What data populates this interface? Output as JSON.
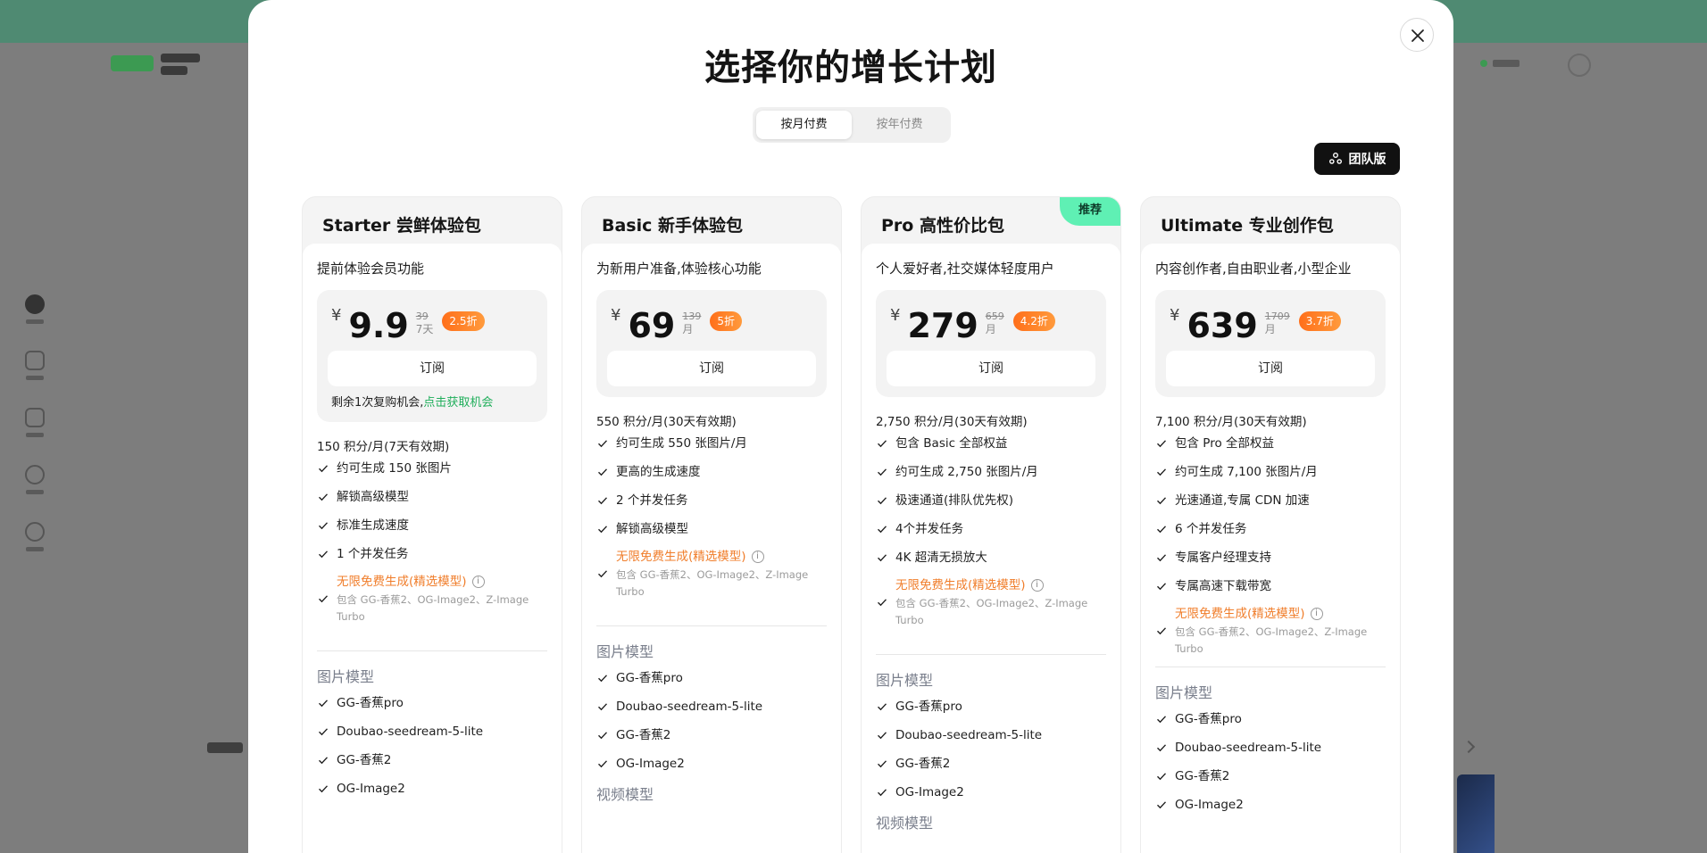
{
  "modal": {
    "title": "选择你的增长计划",
    "billing": {
      "monthly": "按月付费",
      "yearly": "按年付费",
      "active": "monthly"
    },
    "team_button": "团队版",
    "close_label": "关闭"
  },
  "plans": [
    {
      "name": "Starter 尝鲜体验包",
      "tagline": "提前体验会员功能",
      "currency": "¥",
      "price": "9.9",
      "original_price": "39",
      "period": "7天",
      "discount": "2.5折",
      "subscribe": "订阅",
      "note": "剩余1次复购机会,",
      "note_link": "点击获取机会",
      "credits": "150 积分/月(7天有效期)",
      "features": [
        "约可生成 150 张图片",
        "解锁高级模型",
        "标准生成速度",
        "1 个并发任务"
      ],
      "free_title": "无限免费生成(精选模型)",
      "free_sub": "包含 GG-香蕉2、OG-Image2、Z-Image Turbo",
      "image_models_title": "图片模型",
      "image_models": [
        "GG-香蕉pro",
        "Doubao-seedream-5-lite",
        "GG-香蕉2",
        "OG-Image2"
      ]
    },
    {
      "name": "Basic 新手体验包",
      "tagline": "为新用户准备,体验核心功能",
      "currency": "¥",
      "price": "69",
      "original_price": "139",
      "period": "月",
      "discount": "5折",
      "subscribe": "订阅",
      "credits": "550 积分/月(30天有效期)",
      "features": [
        "约可生成 550 张图片/月",
        "更高的生成速度",
        "2 个并发任务",
        "解锁高级模型"
      ],
      "free_title": "无限免费生成(精选模型)",
      "free_sub": "包含 GG-香蕉2、OG-Image2、Z-Image Turbo",
      "image_models_title": "图片模型",
      "image_models": [
        "GG-香蕉pro",
        "Doubao-seedream-5-lite",
        "GG-香蕉2",
        "OG-Image2"
      ],
      "video_models_title": "视频模型"
    },
    {
      "name": "Pro 高性价比包",
      "badge": "推荐",
      "tagline": "个人爱好者,社交媒体轻度用户",
      "currency": "¥",
      "price": "279",
      "original_price": "659",
      "period": "月",
      "discount": "4.2折",
      "subscribe": "订阅",
      "credits": "2,750 积分/月(30天有效期)",
      "features": [
        "包含 Basic 全部权益",
        "约可生成 2,750 张图片/月",
        "极速通道(排队优先权)",
        "4个并发任务",
        "4K 超清无损放大"
      ],
      "free_title": "无限免费生成(精选模型)",
      "free_sub": "包含 GG-香蕉2、OG-Image2、Z-Image Turbo",
      "image_models_title": "图片模型",
      "image_models": [
        "GG-香蕉pro",
        "Doubao-seedream-5-lite",
        "GG-香蕉2",
        "OG-Image2"
      ],
      "video_models_title": "视频模型"
    },
    {
      "name": "Ultimate 专业创作包",
      "tagline": "内容创作者,自由职业者,小型企业",
      "currency": "¥",
      "price": "639",
      "original_price": "1709",
      "period": "月",
      "discount": "3.7折",
      "subscribe": "订阅",
      "credits": "7,100 积分/月(30天有效期)",
      "features": [
        "包含 Pro 全部权益",
        "约可生成 7,100 张图片/月",
        "光速通道,专属 CDN 加速",
        "6 个并发任务",
        "专属客户经理支持",
        "专属高速下载带宽"
      ],
      "free_title": "无限免费生成(精选模型)",
      "free_sub": "包含 GG-香蕉2、OG-Image2、Z-Image Turbo",
      "image_models_title": "图片模型",
      "image_models": [
        "GG-香蕉pro",
        "Doubao-seedream-5-lite",
        "GG-香蕉2",
        "OG-Image2"
      ]
    }
  ],
  "colors": {
    "accent_green": "#5ff0b4",
    "discount_orange": "#ff7a22",
    "free_orange": "#f07d2a",
    "link_green": "#1fae5a",
    "team_button_bg": "#111111"
  },
  "icons": {
    "close": "close-icon",
    "team": "team-icon",
    "check": "check-icon",
    "info": "info-icon"
  }
}
